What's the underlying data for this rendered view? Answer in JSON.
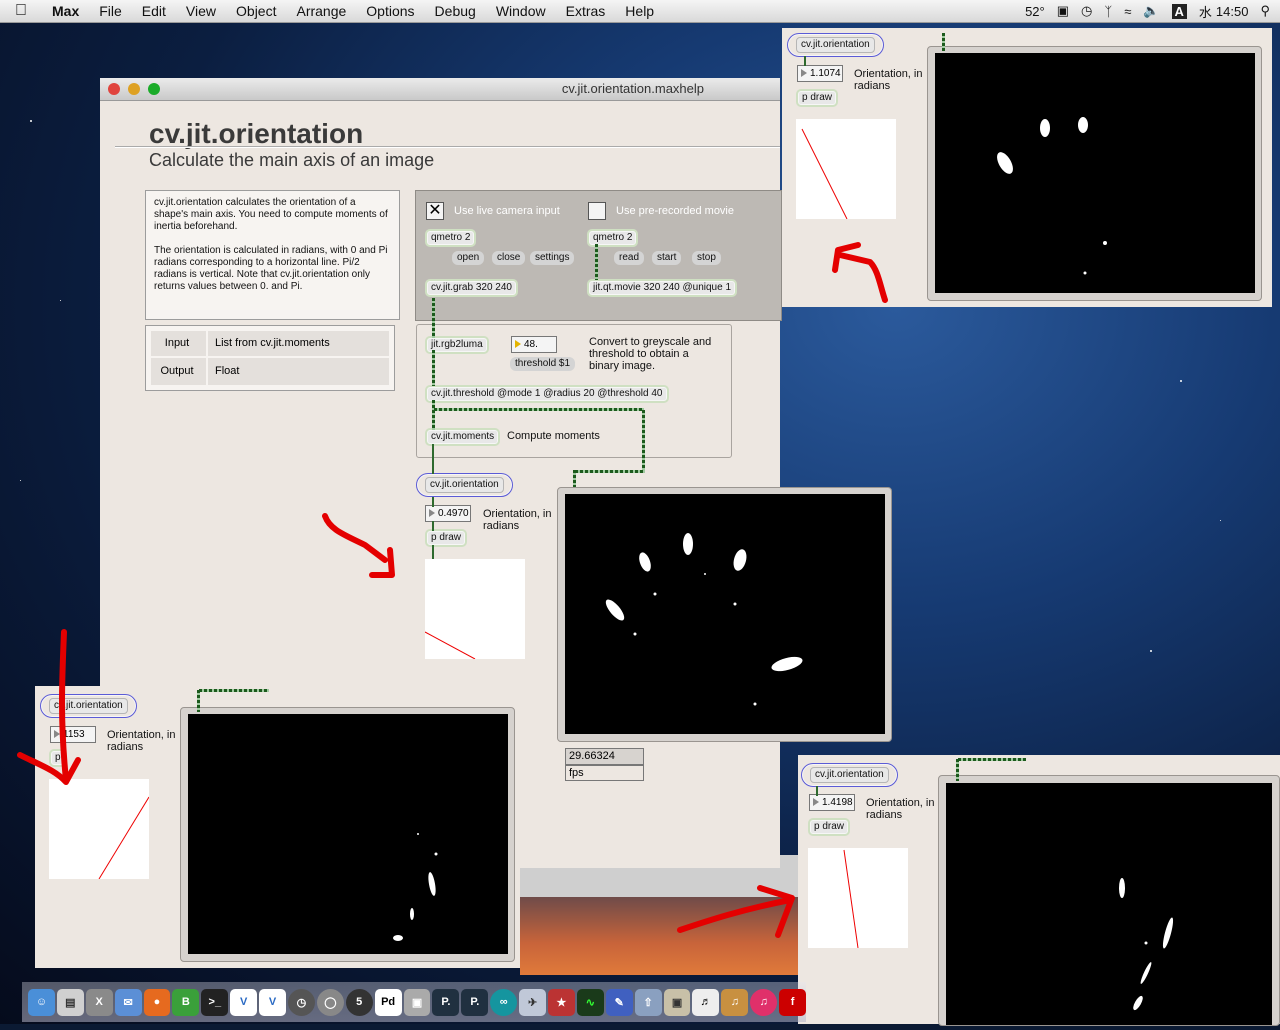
{
  "menubar": {
    "app": "Max",
    "items": [
      "File",
      "Edit",
      "View",
      "Object",
      "Arrange",
      "Options",
      "Debug",
      "Window",
      "Extras",
      "Help"
    ],
    "temperature": "52°",
    "input_source": "A",
    "day": "水",
    "time": "14:50"
  },
  "window": {
    "title": "cv.jit.orientation.maxhelp",
    "heading": "cv.jit.orientation",
    "subheading": "Calculate the main axis of an image",
    "description": "cv.jit.orientation calculates the orientation of a shape's main axis. You need to compute moments of inertia beforehand.\n\nThe orientation is calculated in radians, with 0 and Pi radians corresponding to a horizontal line. Pi/2 radians is vertical. Note that cv.jit.orientation only returns values between 0. and Pi.",
    "io_table": [
      {
        "key": "Input",
        "value": "List from cv.jit.moments"
      },
      {
        "key": "Output",
        "value": "Float"
      }
    ]
  },
  "patch": {
    "toggle_live_label": "Use live camera input",
    "toggle_live_checked": true,
    "toggle_movie_label": "Use pre-recorded movie",
    "toggle_movie_checked": false,
    "qmetro_left": "qmetro 2",
    "qmetro_right": "qmetro 2",
    "msg_open": "open",
    "msg_close": "close",
    "msg_settings": "settings",
    "msg_read": "read",
    "msg_start": "start",
    "msg_stop": "stop",
    "grab": "cv.jit.grab 320 240",
    "movie": "jit.qt.movie 320 240 @unique 1",
    "rgb2luma": "jit.rgb2luma",
    "threshold_value": "48.",
    "threshold_msg": "threshold $1",
    "convert_note": "Convert to greyscale and threshold to obtain a binary image.",
    "threshold_obj": "cv.jit.threshold @mode 1 @radius 20 @threshold 40",
    "moments": "cv.jit.moments",
    "moments_note": "Compute moments",
    "orientation": "cv.jit.orientation",
    "orientation_value": "0.4970",
    "orientation_note": "Orientation, in radians",
    "draw": "p draw",
    "fps_value": "29.66324",
    "fps_label": "fps"
  },
  "snapshots": {
    "top_right": {
      "object": "cv.jit.orientation",
      "value": "1.1074",
      "note": "Orientation, in radians",
      "draw": "p draw"
    },
    "bottom_left": {
      "object": "cv.jit.orientation",
      "value": "1153",
      "note": "Orientation, in radians",
      "draw": "p"
    },
    "bottom_right": {
      "object": "cv.jit.orientation",
      "value": "1.4198",
      "note": "Orientation, in radians",
      "draw": "p draw"
    }
  },
  "dock": {
    "items": [
      "finder",
      "preview",
      "x11",
      "mail",
      "firefox",
      "bbedit",
      "terminal",
      "vnc",
      "vnc2",
      "clock",
      "itunes-sync",
      "max5",
      "pd",
      "cube",
      "pd-extended",
      "pd-2",
      "arduino",
      "plane",
      "app",
      "activity",
      "notes",
      "share",
      "archive",
      "piano",
      "guitar",
      "itunes",
      "flash"
    ],
    "max_label": "5",
    "pd_label": "Pd",
    "p_label_1": "P.",
    "p_label_2": "P."
  },
  "colors": {
    "accent_blue": "#5b5bd6",
    "cable_green": "#2e6a2e",
    "annotation_red": "#e40000"
  }
}
